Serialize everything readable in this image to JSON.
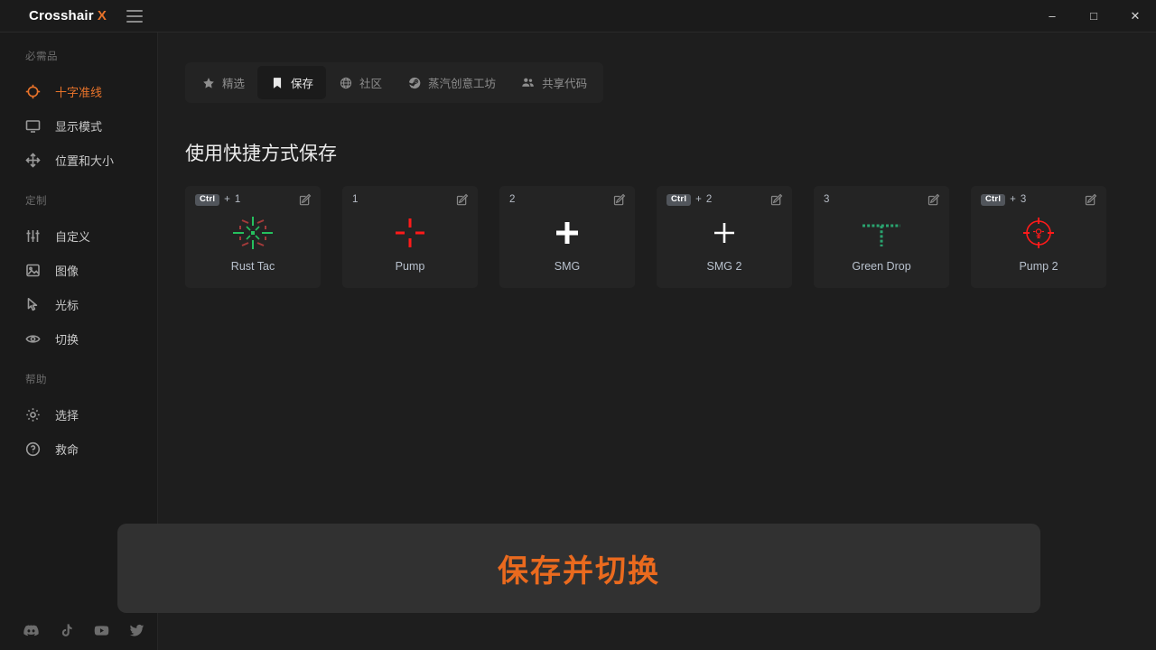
{
  "window": {
    "brand_main": "Crosshair",
    "brand_accent": "X",
    "menu_icon": "hamburger-icon",
    "controls": {
      "minimize": "–",
      "maximize": "□",
      "close": "✕"
    }
  },
  "sidebar": {
    "groups": [
      {
        "title": "必需品",
        "items": [
          {
            "label": "十字准线",
            "icon": "crosshair-icon",
            "active": true
          },
          {
            "label": "显示模式",
            "icon": "monitor-icon",
            "active": false
          },
          {
            "label": "位置和大小",
            "icon": "move-icon",
            "active": false
          }
        ]
      },
      {
        "title": "定制",
        "items": [
          {
            "label": "自定义",
            "icon": "sliders-icon",
            "active": false
          },
          {
            "label": "图像",
            "icon": "image-icon",
            "active": false
          },
          {
            "label": "光标",
            "icon": "cursor-icon",
            "active": false
          },
          {
            "label": "切换",
            "icon": "eye-icon",
            "active": false
          }
        ]
      },
      {
        "title": "帮助",
        "items": [
          {
            "label": "选择",
            "icon": "gear-icon",
            "active": false
          },
          {
            "label": "救命",
            "icon": "question-circle-icon",
            "active": false
          }
        ]
      }
    ],
    "socials": [
      {
        "name": "discord-icon"
      },
      {
        "name": "tiktok-icon"
      },
      {
        "name": "youtube-icon"
      },
      {
        "name": "twitter-icon"
      }
    ]
  },
  "main": {
    "tabs": [
      {
        "label": "精选",
        "icon": "star-icon",
        "active": false
      },
      {
        "label": "保存",
        "icon": "bookmark-icon",
        "active": true
      },
      {
        "label": "社区",
        "icon": "globe-icon",
        "active": false
      },
      {
        "label": "蒸汽创意工坊",
        "icon": "steam-icon",
        "active": false
      },
      {
        "label": "共享代码",
        "icon": "people-icon",
        "active": false
      }
    ],
    "heading": "使用快捷方式保存",
    "cards": [
      {
        "name": "Rust Tac",
        "modifier": "Ctrl",
        "key": "1",
        "preview": "rust-tac-crosshair"
      },
      {
        "name": "Pump",
        "modifier": "",
        "key": "1",
        "preview": "pump-crosshair"
      },
      {
        "name": "SMG",
        "modifier": "",
        "key": "2",
        "preview": "smg-crosshair"
      },
      {
        "name": "SMG 2",
        "modifier": "Ctrl",
        "key": "2",
        "preview": "smg2-crosshair"
      },
      {
        "name": "Green Drop",
        "modifier": "",
        "key": "3",
        "preview": "green-drop-crosshair"
      },
      {
        "name": "Pump 2",
        "modifier": "Ctrl",
        "key": "3",
        "preview": "pump2-crosshair"
      }
    ],
    "edit_icon": "edit-pencil-icon",
    "key_separator": "+"
  },
  "footer": {
    "save_and_switch_label": "保存并切换"
  },
  "colors": {
    "accent": "#e8732a",
    "save_label": "#ea6a1e",
    "app_bg": "#1e1e1e",
    "sidebar_bg": "#1a1a1a",
    "card_bg": "#242424",
    "savebar_bg": "#313131",
    "crosshair_green": "#2aa36f",
    "crosshair_red": "#ff1a1a",
    "crosshair_white": "#ffffff"
  }
}
